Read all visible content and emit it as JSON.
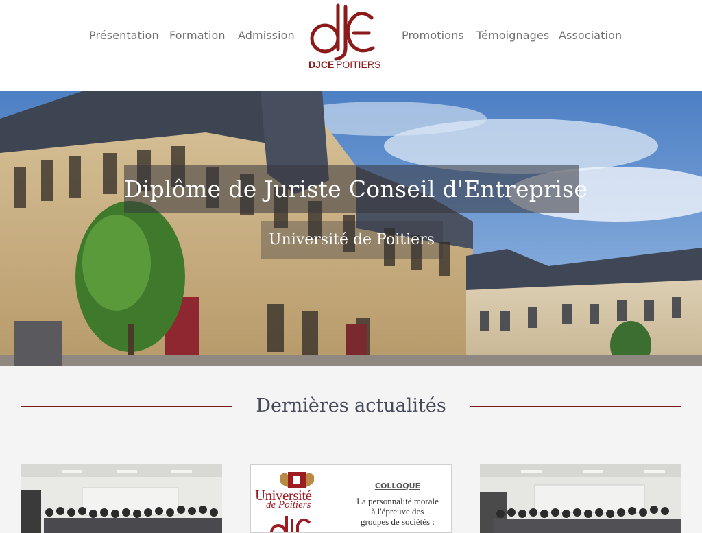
{
  "nav": {
    "left": [
      "Présentation",
      "Formation",
      "Admission"
    ],
    "right": [
      "Promotions",
      "Témoignages",
      "Association"
    ]
  },
  "logo": {
    "mark": "djce",
    "wordmark_bold": "DJCE",
    "wordmark_light": "POITIERS",
    "color": "#8b1a1a"
  },
  "hero": {
    "title": "Diplôme de Juriste Conseil d'Entreprise",
    "subtitle": "Université de Poitiers"
  },
  "news": {
    "heading": "Dernières actualités",
    "rule_color": "#7a1d1d",
    "cards": [
      {
        "image": "group-photo"
      },
      {
        "image": "colloque-poster",
        "univ_name": "Université",
        "univ_de": "de Poitiers",
        "label": "COLLOQUE",
        "lines": [
          "La personnalité morale",
          "à l'épreuve des",
          "groupes de sociétés :"
        ]
      },
      {
        "image": "group-photo"
      }
    ]
  }
}
